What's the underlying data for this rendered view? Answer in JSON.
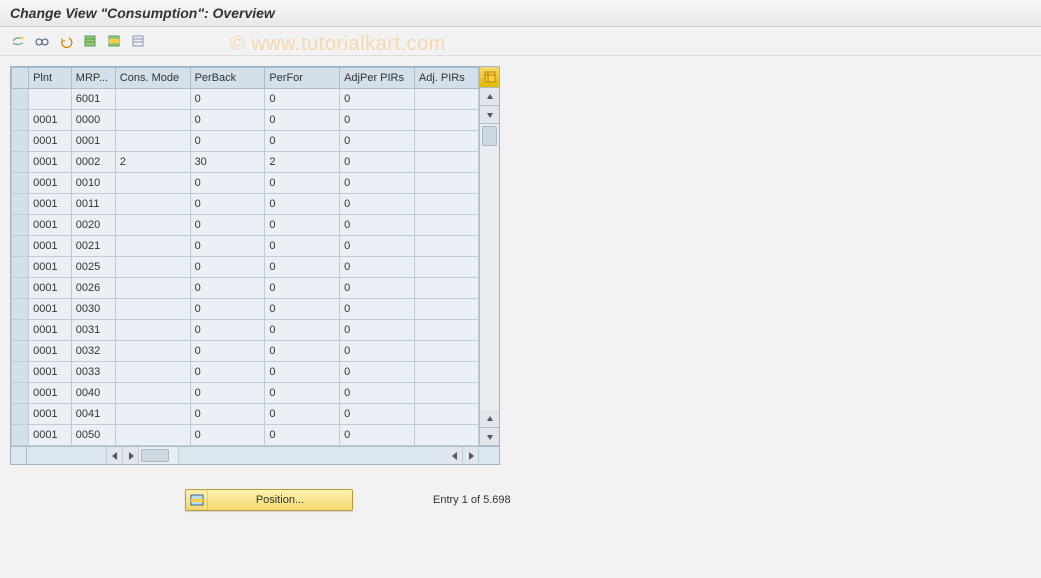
{
  "header": {
    "title": "Change View \"Consumption\": Overview"
  },
  "watermark": "© www.tutorialkart.com",
  "toolbar": {
    "items": [
      {
        "name": "other-view-icon"
      },
      {
        "name": "glasses-icon"
      },
      {
        "name": "undo-icon"
      },
      {
        "name": "select-all-icon"
      },
      {
        "name": "select-block-icon"
      },
      {
        "name": "deselect-all-icon"
      }
    ]
  },
  "table": {
    "headers": [
      "Plnt",
      "MRP...",
      "Cons. Mode",
      "PerBack",
      "PerFor",
      "AdjPer PIRs",
      "Adj. PIRs"
    ],
    "rows": [
      [
        "",
        "6001",
        "",
        "0",
        "0",
        "0",
        ""
      ],
      [
        "0001",
        "0000",
        "",
        "0",
        "0",
        "0",
        ""
      ],
      [
        "0001",
        "0001",
        "",
        "0",
        "0",
        "0",
        ""
      ],
      [
        "0001",
        "0002",
        "2",
        "30",
        "2",
        "0",
        ""
      ],
      [
        "0001",
        "0010",
        "",
        "0",
        "0",
        "0",
        ""
      ],
      [
        "0001",
        "0011",
        "",
        "0",
        "0",
        "0",
        ""
      ],
      [
        "0001",
        "0020",
        "",
        "0",
        "0",
        "0",
        ""
      ],
      [
        "0001",
        "0021",
        "",
        "0",
        "0",
        "0",
        ""
      ],
      [
        "0001",
        "0025",
        "",
        "0",
        "0",
        "0",
        ""
      ],
      [
        "0001",
        "0026",
        "",
        "0",
        "0",
        "0",
        ""
      ],
      [
        "0001",
        "0030",
        "",
        "0",
        "0",
        "0",
        ""
      ],
      [
        "0001",
        "0031",
        "",
        "0",
        "0",
        "0",
        ""
      ],
      [
        "0001",
        "0032",
        "",
        "0",
        "0",
        "0",
        ""
      ],
      [
        "0001",
        "0033",
        "",
        "0",
        "0",
        "0",
        ""
      ],
      [
        "0001",
        "0040",
        "",
        "0",
        "0",
        "0",
        ""
      ],
      [
        "0001",
        "0041",
        "",
        "0",
        "0",
        "0",
        ""
      ],
      [
        "0001",
        "0050",
        "",
        "0",
        "0",
        "0",
        ""
      ]
    ]
  },
  "footer": {
    "position_label": "Position...",
    "entry_info": "Entry 1 of 5.698"
  }
}
